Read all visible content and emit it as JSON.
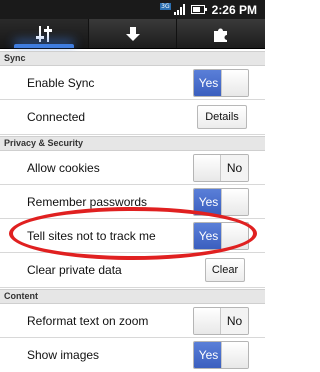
{
  "status_bar": {
    "network": "3G",
    "time": "2:26 PM",
    "icons": [
      "network-3g-icon",
      "signal-icon",
      "battery-icon"
    ]
  },
  "tabs": [
    {
      "icon": "settings-sliders-icon",
      "active": true
    },
    {
      "icon": "download-arrow-icon",
      "active": false
    },
    {
      "icon": "puzzle-addons-icon",
      "active": false
    }
  ],
  "sections": {
    "sync": "Sync",
    "privacy": "Privacy & Security",
    "content": "Content"
  },
  "rows": {
    "enable_sync": {
      "label": "Enable Sync",
      "value": "Yes"
    },
    "connected": {
      "label": "Connected",
      "button": "Details"
    },
    "allow_cookies": {
      "label": "Allow cookies",
      "value": "No"
    },
    "remember_passwords": {
      "label": "Remember passwords",
      "value": "Yes"
    },
    "do_not_track": {
      "label": "Tell sites not to track me",
      "value": "Yes"
    },
    "clear_private": {
      "label": "Clear private data",
      "button": "Clear"
    },
    "reformat_text": {
      "label": "Reformat text on zoom",
      "value": "No"
    },
    "show_images": {
      "label": "Show images",
      "value": "Yes"
    }
  },
  "colors": {
    "accent": "#3b5fbf",
    "highlight_ring": "#e02020",
    "tab_glow": "#3f7de0"
  }
}
